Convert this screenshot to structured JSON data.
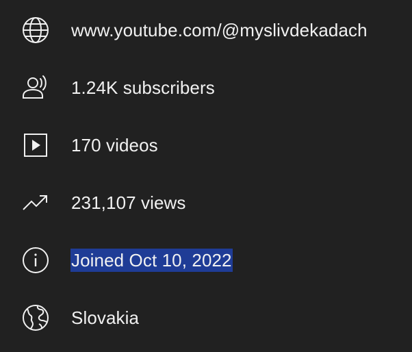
{
  "channel_about": {
    "link": {
      "icon": "globe-icon",
      "text": "www.youtube.com/@myslivdekadach"
    },
    "subscribers": {
      "icon": "subscribers-icon",
      "text": "1.24K subscribers"
    },
    "videos": {
      "icon": "play-box-icon",
      "text": "170 videos"
    },
    "views": {
      "icon": "trending-icon",
      "text": "231,107 views"
    },
    "joined": {
      "icon": "info-icon",
      "text": "Joined Oct 10, 2022",
      "selected": true,
      "highlight_color": "#1f3c96"
    },
    "country": {
      "icon": "earth-icon",
      "text": "Slovakia"
    }
  },
  "colors": {
    "background": "#212121",
    "text": "#f1f1f1",
    "selection": "#1f3c96"
  }
}
